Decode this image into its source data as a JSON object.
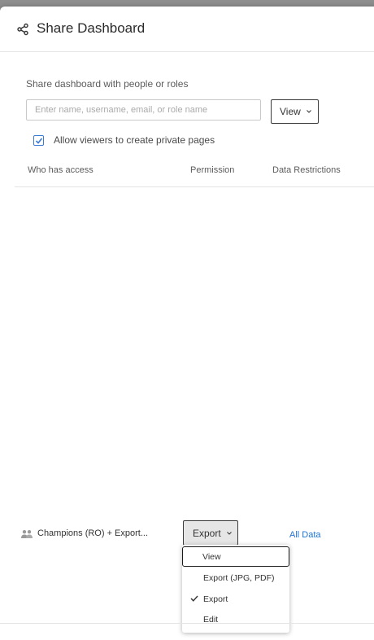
{
  "dialog": {
    "title": "Share Dashboard",
    "icon": "share-icon"
  },
  "share": {
    "label": "Share dashboard with people or roles",
    "placeholder": "Enter name, username, email, or role name",
    "value": "",
    "permission_button": "View",
    "allow_private_pages": {
      "label": "Allow viewers to create private pages",
      "checked": true
    }
  },
  "table": {
    "headers": {
      "who": "Who has access",
      "permission": "Permission",
      "restrictions": "Data Restrictions"
    },
    "rows": [
      {
        "icon": "group-icon",
        "name": "Champions (RO) + Export...",
        "permission": "Export",
        "restrictions": "All Data"
      }
    ]
  },
  "permission_dropdown": {
    "items": [
      {
        "label": "View",
        "focused": true,
        "selected": false
      },
      {
        "label": "Export (JPG, PDF)",
        "focused": false,
        "selected": false
      },
      {
        "label": "Export",
        "focused": false,
        "selected": true
      },
      {
        "label": "Edit",
        "focused": false,
        "selected": false
      }
    ]
  },
  "colors": {
    "accent": "#1f73d6",
    "checkbox": "#3b7bd4",
    "text": "#333333",
    "muted": "#5c5c5c",
    "overlay": "#8e8e8e"
  }
}
